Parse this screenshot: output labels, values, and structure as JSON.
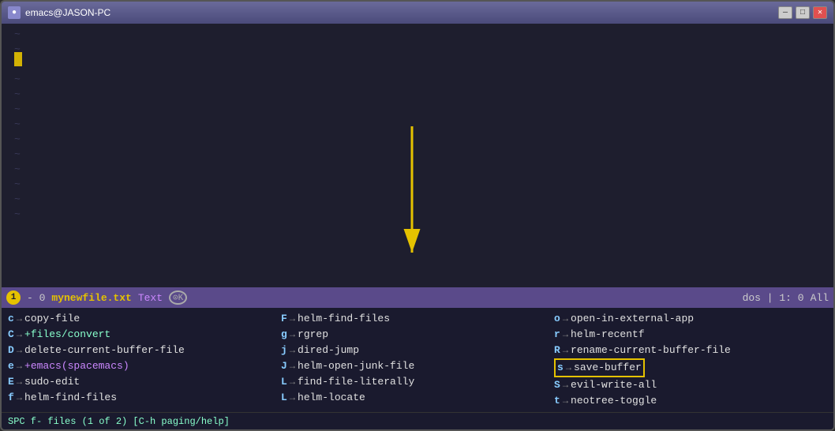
{
  "window": {
    "title": "emacs@JASON-PC",
    "icon": "●"
  },
  "controls": {
    "minimize": "—",
    "maximize": "□",
    "close": "✕"
  },
  "editor": {
    "tildes": [
      "~",
      "~",
      "~",
      "~",
      "~",
      "~",
      "~",
      "~",
      "~",
      "~",
      "~",
      "~",
      "~",
      "~",
      "~",
      "~"
    ]
  },
  "statusbar": {
    "num": "1",
    "dash": "- 0",
    "filename": "mynewfile.txt",
    "mode": "Text",
    "yk": "⊙K",
    "right": "dos | 1: 0",
    "all": "All"
  },
  "menu": {
    "col1": [
      {
        "key": "c",
        "arrow": "→",
        "cmd": "copy-file",
        "style": "normal"
      },
      {
        "key": "C",
        "arrow": "→",
        "cmd": "+files/convert",
        "style": "cyan"
      },
      {
        "key": "D",
        "arrow": "→",
        "cmd": "delete-current-buffer-file",
        "style": "normal"
      },
      {
        "key": "e",
        "arrow": "→",
        "cmd": "+emacs(spacemacs)",
        "style": "purple"
      },
      {
        "key": "E",
        "arrow": "→",
        "cmd": "sudo-edit",
        "style": "normal"
      },
      {
        "key": "f",
        "arrow": "→",
        "cmd": "helm-find-files",
        "style": "normal"
      }
    ],
    "col2": [
      {
        "key": "F",
        "arrow": "→",
        "cmd": "helm-find-files",
        "style": "normal"
      },
      {
        "key": "g",
        "arrow": "→",
        "cmd": "rgrep",
        "style": "normal"
      },
      {
        "key": "j",
        "arrow": "→",
        "cmd": "dired-jump",
        "style": "normal"
      },
      {
        "key": "J",
        "arrow": "→",
        "cmd": "helm-open-junk-file",
        "style": "normal"
      },
      {
        "key": "L",
        "arrow": "→",
        "cmd": "find-file-literally",
        "style": "normal"
      },
      {
        "key": "L",
        "arrow": "→",
        "cmd": "helm-locate",
        "style": "normal"
      }
    ],
    "col3": [
      {
        "key": "o",
        "arrow": "→",
        "cmd": "open-in-external-app",
        "style": "normal"
      },
      {
        "key": "r",
        "arrow": "→",
        "cmd": "helm-recentf",
        "style": "normal"
      },
      {
        "key": "R",
        "arrow": "→",
        "cmd": "rename-current-buffer-file",
        "style": "normal"
      },
      {
        "key": "s",
        "arrow": "→",
        "cmd": "save-buffer",
        "style": "highlighted"
      },
      {
        "key": "S",
        "arrow": "→",
        "cmd": "evil-write-all",
        "style": "normal"
      },
      {
        "key": "t",
        "arrow": "→",
        "cmd": "neotree-toggle",
        "style": "normal"
      }
    ]
  },
  "bottombar": {
    "text": "SPC f- files (1 of 2) [C-h paging/help]"
  }
}
